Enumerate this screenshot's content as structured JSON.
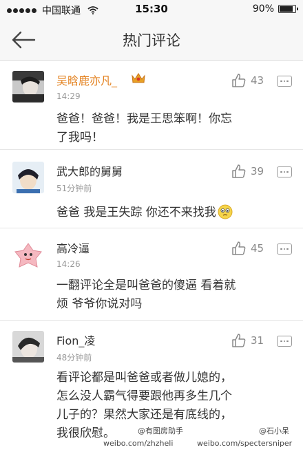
{
  "status_bar": {
    "carrier": "中国联通",
    "time": "15:30",
    "battery": "90%",
    "battery_level": 0.9,
    "signal_dots": 5
  },
  "header": {
    "title": "热门评论",
    "back_icon": "arrow-left-icon"
  },
  "comments": [
    {
      "username": "吴晗鹿亦凡_",
      "badge_icon": "crown-icon",
      "time": "14:29",
      "likes": "43",
      "text_line1": "爸爸！爸爸！我是王思笨啊！你忘",
      "text_line2": "了我吗！"
    },
    {
      "username": "武大郎的舅舅",
      "time": "51分钟前",
      "likes": "39",
      "text_line1": "爸爸  我是王失踪   你还不来找我",
      "emoji_icon": "teary-face-icon"
    },
    {
      "username": "高冷逼",
      "time": "14:26",
      "likes": "45",
      "text_line1": "一翻评论全是叫爸爸的傻逼 看着就",
      "text_line2": "烦 爷爷你说对吗"
    },
    {
      "username": "Fion_凌",
      "time": "48分钟前",
      "likes": "31",
      "text_line1": "看评论都是叫爸爸或者做儿媳的，",
      "text_line2": "怎么没人霸气得要跟他再多生几个",
      "text_line3": "儿子的？果然大家还是有底线的，",
      "text_line4": "我很欣慰。"
    }
  ],
  "watermark": {
    "handle1": "@有图房助手",
    "handle2": "@石小呆",
    "url1": "weibo.com/zhzheli",
    "url2": "weibo.com/spectersniper"
  },
  "colors": {
    "vip_username": "#e3801d",
    "text": "#333333",
    "muted": "#999999"
  }
}
